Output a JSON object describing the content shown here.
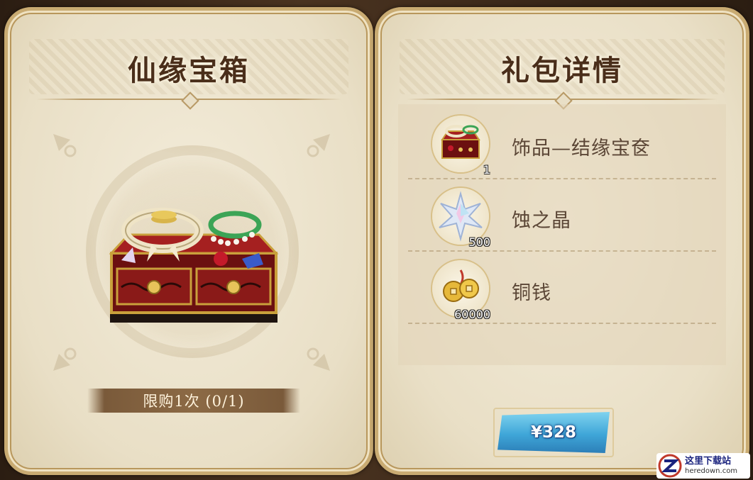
{
  "left_panel": {
    "title": "仙缘宝箱",
    "chest_icon": "treasure-chest-icon",
    "limit_text": "限购1次 (0/1)"
  },
  "right_panel": {
    "title": "礼包详情",
    "rewards": [
      {
        "name": "饰品—结缘宝奁",
        "quantity": "1",
        "icon": "jewelry-box-icon"
      },
      {
        "name": "蚀之晶",
        "quantity": "500",
        "icon": "crystal-star-icon"
      },
      {
        "name": "铜钱",
        "quantity": "60000",
        "icon": "copper-coins-icon"
      }
    ],
    "price_label": "¥328"
  },
  "watermark": {
    "cn": "这里下载站",
    "en": "heredown.com"
  },
  "colors": {
    "panel": "#ebe1c8",
    "title": "#4a2e1a",
    "price_button": "#3fa6d8",
    "banner": "#8c6a45"
  }
}
